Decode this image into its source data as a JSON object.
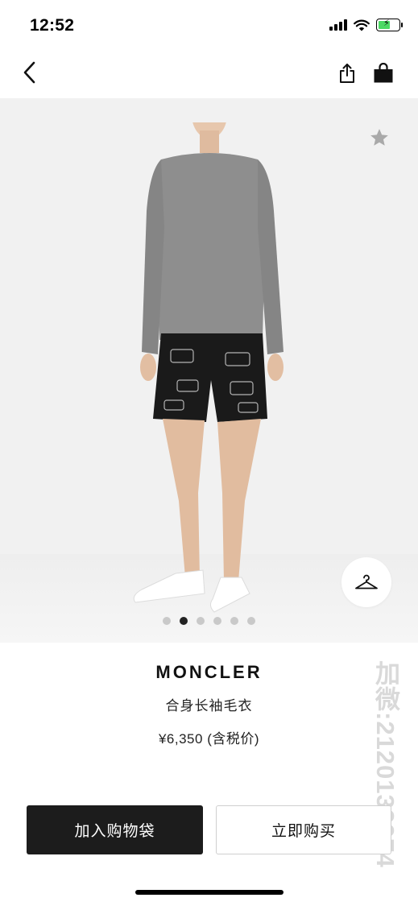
{
  "status_bar": {
    "time": "12:52",
    "icons": [
      "signal-icon",
      "wifi-icon",
      "battery-charging-icon"
    ]
  },
  "nav": {
    "icons": [
      "chevron-left-icon",
      "share-icon",
      "shopping-bag-icon"
    ]
  },
  "gallery": {
    "image_count": 6,
    "active_index": 1,
    "icons": [
      "star-icon",
      "hanger-icon"
    ],
    "colors": {
      "background": "#f1f1f1",
      "sweater": "#8e8e8e",
      "shorts": "#1a1a1a"
    }
  },
  "product": {
    "brand": "MONCLER",
    "name": "合身长袖毛衣",
    "price": "¥6,350 (含税价)"
  },
  "watermark": "加微:2120132974",
  "actions": {
    "add_to_bag": "加入购物袋",
    "buy_now": "立即购买"
  },
  "colors": {
    "primary_button": "#1c1c1c",
    "active_dot": "#222222",
    "inactive_dot": "#c9c9c9"
  }
}
